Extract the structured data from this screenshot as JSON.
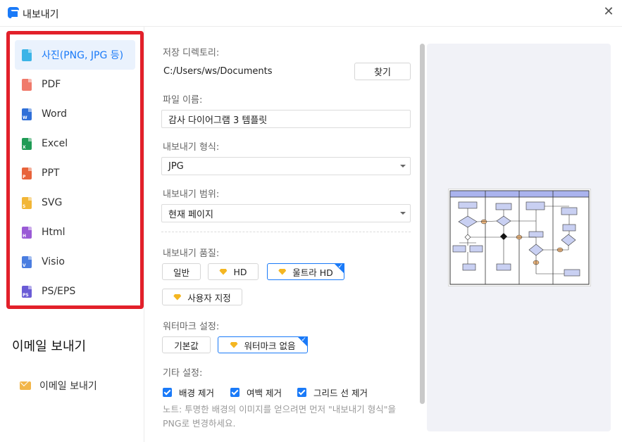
{
  "window": {
    "title": "내보내기"
  },
  "formats": [
    {
      "label": "사진(PNG, JPG 등)",
      "icon": "image-icon",
      "color": "#3cb4e7",
      "letter": "",
      "active": true
    },
    {
      "label": "PDF",
      "icon": "pdf-icon",
      "color": "#f07a6b",
      "letter": "",
      "active": false
    },
    {
      "label": "Word",
      "icon": "word-icon",
      "color": "#2f6fd8",
      "letter": "W",
      "active": false
    },
    {
      "label": "Excel",
      "icon": "excel-icon",
      "color": "#1f9b55",
      "letter": "X",
      "active": false
    },
    {
      "label": "PPT",
      "icon": "ppt-icon",
      "color": "#e8633b",
      "letter": "P",
      "active": false
    },
    {
      "label": "SVG",
      "icon": "svg-icon",
      "color": "#f2b637",
      "letter": "S",
      "active": false
    },
    {
      "label": "Html",
      "icon": "html-icon",
      "color": "#9a5ad6",
      "letter": "H",
      "active": false
    },
    {
      "label": "Visio",
      "icon": "visio-icon",
      "color": "#4a7de0",
      "letter": "V",
      "active": false
    },
    {
      "label": "PS/EPS",
      "icon": "ps-eps-icon",
      "color": "#6a5bd6",
      "letter": "PS",
      "active": false
    }
  ],
  "email": {
    "heading": "이메일 보내기",
    "item_label": "이메일 보내기"
  },
  "form": {
    "save_dir_label": "저장 디렉토리:",
    "save_dir_value": "C:/Users/ws/Documents",
    "browse_label": "찾기",
    "filename_label": "파일 이름:",
    "filename_value": "감사 다이어그램 3 템플릿",
    "format_label": "내보내기 형식:",
    "format_value": "JPG",
    "range_label": "내보내기 범위:",
    "range_value": "현재 페이지",
    "quality_label": "내보내기 품질:",
    "quality_options": {
      "normal": "일반",
      "hd": "HD",
      "ultra_hd": "울트라 HD",
      "custom": "사용자 지정"
    },
    "watermark_label": "워터마크 설정:",
    "watermark_options": {
      "default": "기본값",
      "none": "워터마크 없음"
    },
    "other_label": "기타 설정:",
    "checkboxes": {
      "remove_bg": "배경 제거",
      "remove_margin": "여백 제거",
      "remove_grid": "그리드 선 제거"
    },
    "note": "노트: 투명한 배경의 이미지를 얻으려면 먼저 \"내보내기 형식\"을 PNG로 변경하세요."
  },
  "colors": {
    "accent": "#1a7af8",
    "highlight_border": "#e2202a",
    "preview_bg": "#f1f2f7"
  }
}
